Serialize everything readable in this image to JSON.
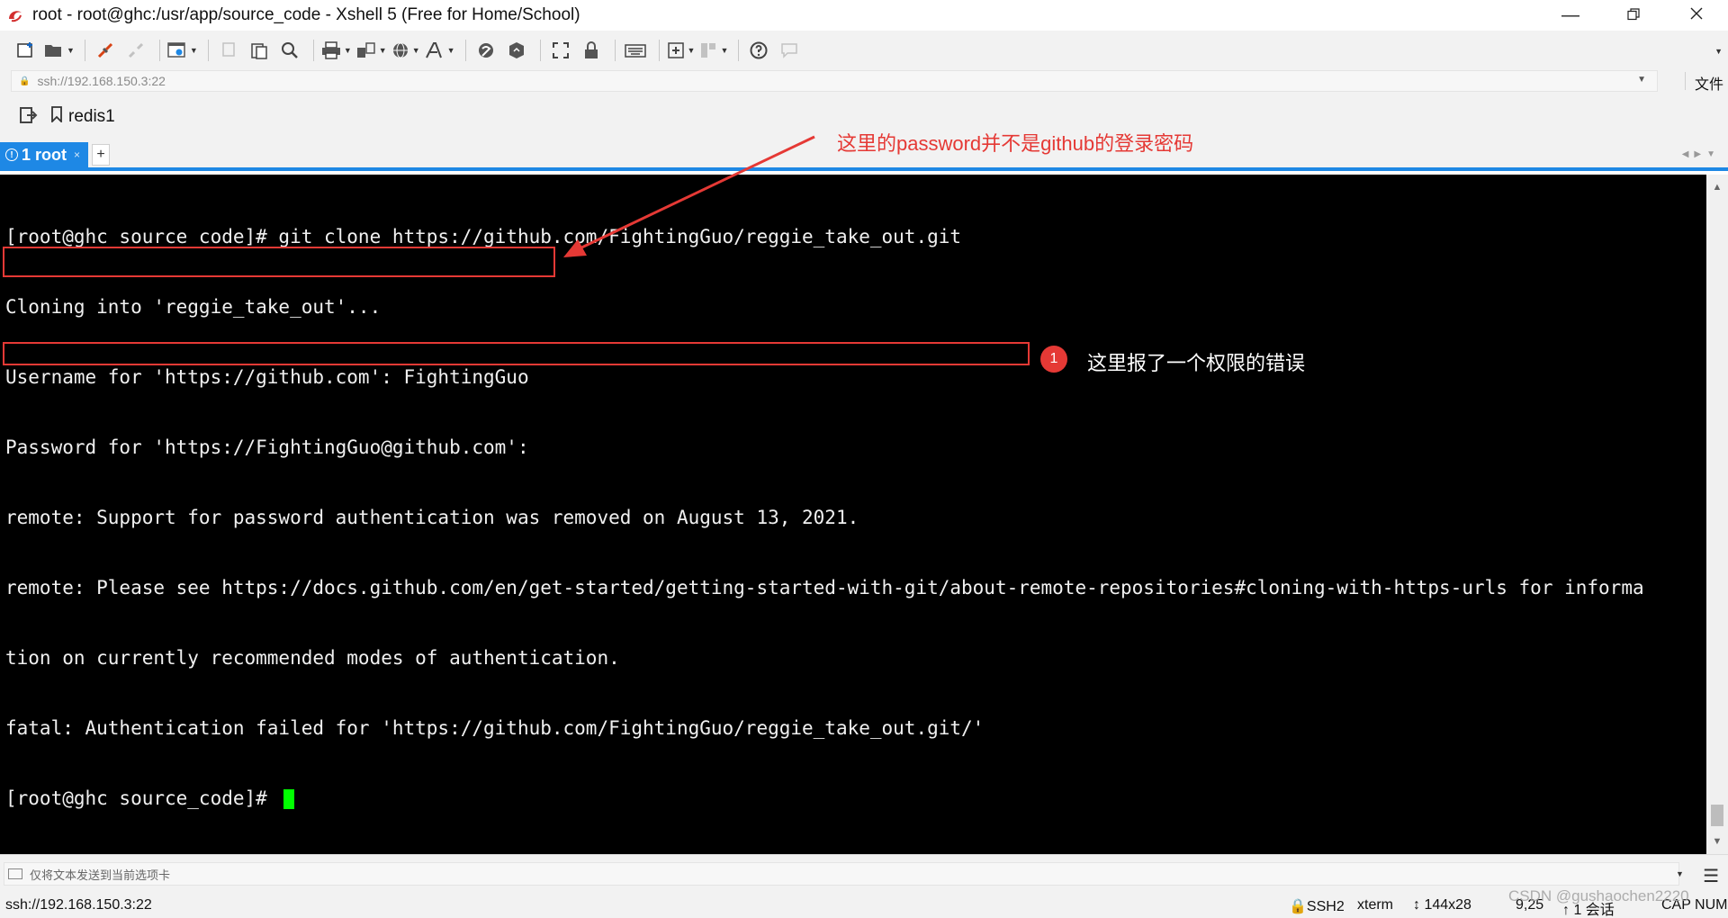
{
  "window": {
    "title": "root - root@ghc:/usr/app/source_code - Xshell 5 (Free for Home/School)"
  },
  "address": {
    "value": "ssh://192.168.150.3:22",
    "extra": "文件"
  },
  "links": {
    "items": [
      {
        "label": "redis1"
      }
    ]
  },
  "tabs": {
    "active": {
      "label": "1 root"
    },
    "add_label": "+"
  },
  "terminal": {
    "lines": [
      "[root@ghc source_code]# git clone https://github.com/FightingGuo/reggie_take_out.git",
      "Cloning into 'reggie_take_out'...",
      "Username for 'https://github.com': FightingGuo",
      "Password for 'https://FightingGuo@github.com':",
      "remote: Support for password authentication was removed on August 13, 2021.",
      "remote: Please see https://docs.github.com/en/get-started/getting-started-with-git/about-remote-repositories#cloning-with-https-urls for informa",
      "tion on currently recommended modes of authentication.",
      "fatal: Authentication failed for 'https://github.com/FightingGuo/reggie_take_out.git/'",
      "[root@ghc source_code]# "
    ],
    "cursor_color": "#00ff00"
  },
  "annotations": {
    "top_note": "这里的password并不是github的登录密码",
    "badge_number": "1",
    "side_note": "这里报了一个权限的错误",
    "color": "#e53935"
  },
  "compose": {
    "placeholder": "仅将文本发送到当前选项卡"
  },
  "status": {
    "connection": "ssh://192.168.150.3:22",
    "protocol": "SSH2",
    "terminal_type": "xterm",
    "size": "144x28",
    "cursor_pos": "9,25",
    "sessions": "1 会话",
    "keys": "CAP NUM"
  },
  "watermark": "CSDN @gushaochen2220",
  "colors": {
    "accent": "#1e88e5",
    "terminal_bg": "#000000",
    "terminal_fg": "#f0f0f0"
  }
}
